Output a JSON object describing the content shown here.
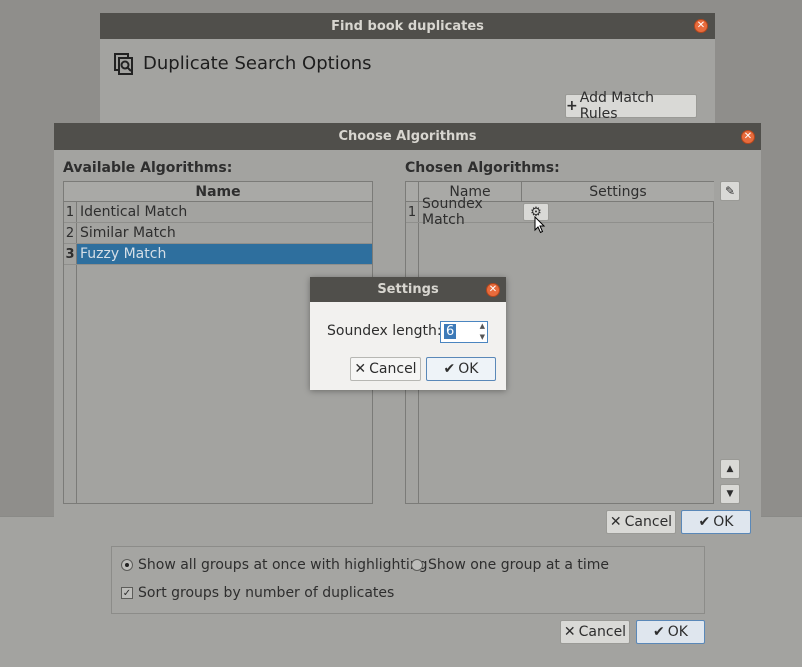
{
  "main_window": {
    "title": "Find book duplicates",
    "heading": "Duplicate Search Options",
    "add_rules_label": "Add Match Rules",
    "option_all_groups": "Show all groups at once with highlighting",
    "option_one_group": "Show one group at a time",
    "option_sort": "Sort groups by number of duplicates",
    "cancel_label": "Cancel",
    "ok_label": "OK"
  },
  "choose_dialog": {
    "title": "Choose Algorithms",
    "available_label": "Available Algorithms:",
    "chosen_label": "Chosen Algorithms:",
    "available_header": "Name",
    "available": [
      {
        "index": "1",
        "name": "Identical Match"
      },
      {
        "index": "2",
        "name": "Similar Match"
      },
      {
        "index": "3",
        "name": "Fuzzy Match"
      }
    ],
    "chosen_headers": {
      "name": "Name",
      "settings": "Settings"
    },
    "chosen": [
      {
        "index": "1",
        "name": "Soundex Match"
      }
    ],
    "cancel_label": "Cancel",
    "ok_label": "OK"
  },
  "settings_dialog": {
    "title": "Settings",
    "field_label": "Soundex length:",
    "value": "6",
    "cancel_label": "Cancel",
    "ok_label": "OK"
  }
}
